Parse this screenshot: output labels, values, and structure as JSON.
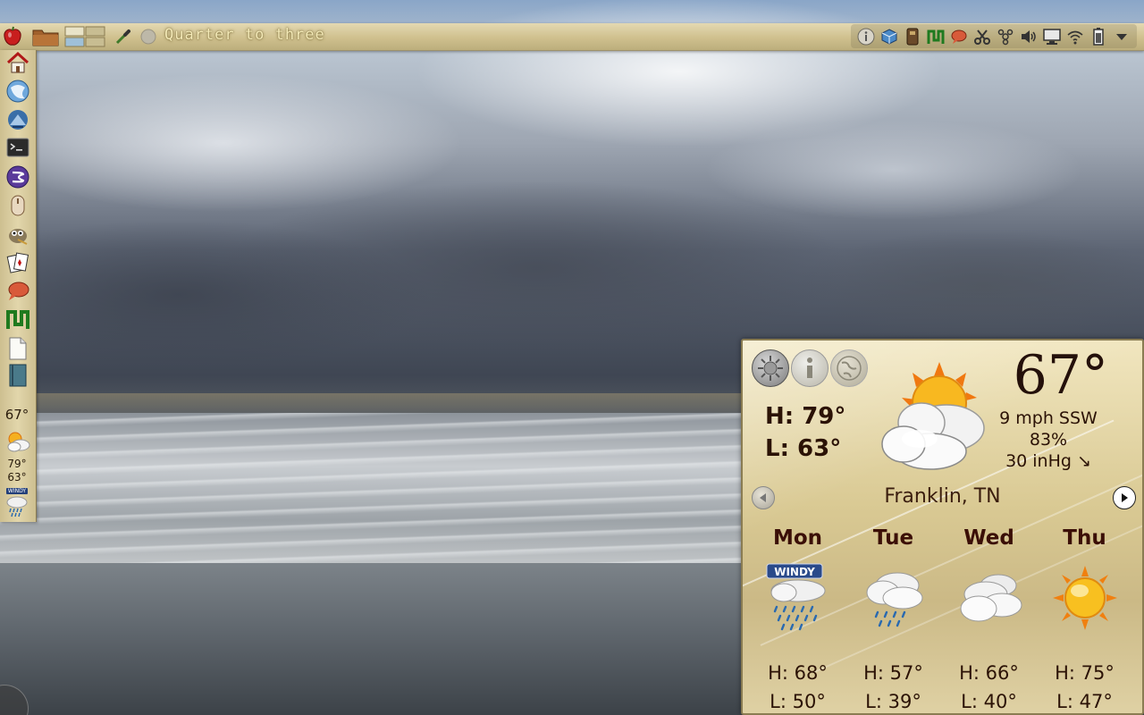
{
  "panel": {
    "title": "Quarter to three",
    "launchers": [
      "app-menu-icon",
      "folder-icon",
      "workspace-switcher-icon",
      "color-picker-icon",
      "dot-icon"
    ],
    "tray": [
      "info-icon",
      "package-icon",
      "usb-icon",
      "graph-icon",
      "chat-icon",
      "scissors-icon",
      "bluetooth-icon",
      "volume-icon",
      "display-icon",
      "wifi-icon",
      "battery-icon",
      "menu-arrow-icon"
    ]
  },
  "dock": {
    "items": [
      "home-icon",
      "browser-icon",
      "thunderbird-icon",
      "terminal-icon",
      "emacs-icon",
      "mouse-icon",
      "gimp-icon",
      "cards-icon",
      "chat-icon",
      "graph-icon",
      "document-icon",
      "notebook-icon"
    ],
    "temp": "67°",
    "hi": "79°",
    "lo": "63°",
    "forecast_badge": "WINDY"
  },
  "weather": {
    "current_temp": "67°",
    "high": "H: 79°",
    "low": "L: 63°",
    "wind": "9 mph SSW",
    "humidity": "83%",
    "pressure": "30 inHg ↘",
    "location": "Franklin, TN",
    "forecast": [
      {
        "day": "Mon",
        "icon": "windy-rain-icon",
        "badge": "WINDY",
        "hi": "H: 68°",
        "lo": "L: 50°"
      },
      {
        "day": "Tue",
        "icon": "rain-icon",
        "hi": "H: 57°",
        "lo": "L: 39°"
      },
      {
        "day": "Wed",
        "icon": "cloudy-icon",
        "hi": "H: 66°",
        "lo": "L: 40°"
      },
      {
        "day": "Thu",
        "icon": "sunny-icon",
        "hi": "H: 75°",
        "lo": "L: 47°"
      }
    ]
  }
}
